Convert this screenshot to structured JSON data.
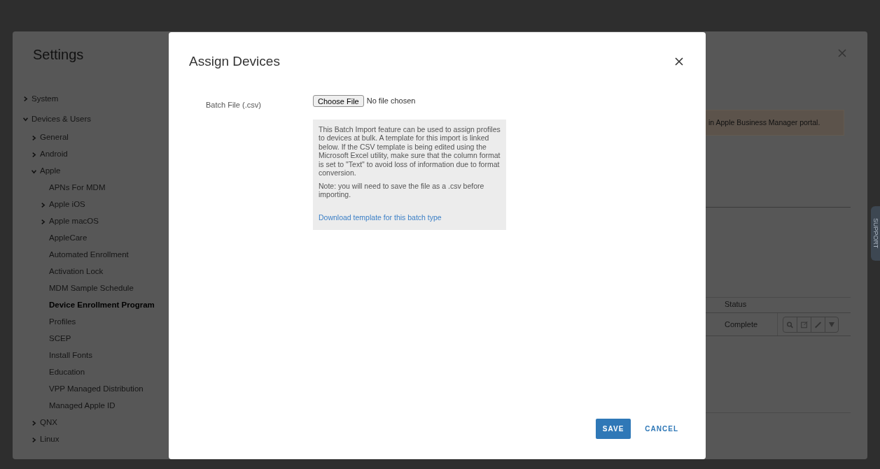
{
  "settings": {
    "title": "Settings",
    "tree": [
      {
        "label": "System",
        "expanded": false,
        "selected": false
      },
      {
        "label": "Devices & Users",
        "expanded": true,
        "selected": false,
        "children": [
          {
            "label": "General",
            "expanded": false,
            "selected": false
          },
          {
            "label": "Android",
            "expanded": false,
            "selected": false
          },
          {
            "label": "Apple",
            "expanded": true,
            "selected": false,
            "children": [
              {
                "label": "APNs For MDM",
                "selected": false
              },
              {
                "label": "Apple iOS",
                "expanded": false,
                "selected": false
              },
              {
                "label": "Apple macOS",
                "expanded": false,
                "selected": false
              },
              {
                "label": "AppleCare",
                "selected": false
              },
              {
                "label": "Automated Enrollment",
                "selected": false
              },
              {
                "label": "Activation Lock",
                "selected": false
              },
              {
                "label": "MDM Sample Schedule",
                "selected": false
              },
              {
                "label": "Device Enrollment Program",
                "selected": true
              },
              {
                "label": "Profiles",
                "selected": false
              },
              {
                "label": "SCEP",
                "selected": false
              },
              {
                "label": "Install Fonts",
                "selected": false
              },
              {
                "label": "Education",
                "selected": false
              },
              {
                "label": "VPP Managed Distribution",
                "selected": false
              },
              {
                "label": "Managed Apple ID",
                "selected": false
              }
            ]
          },
          {
            "label": "QNX",
            "expanded": false,
            "selected": false
          },
          {
            "label": "Linux",
            "expanded": false,
            "selected": false
          }
        ]
      }
    ],
    "banner": "in Apple Business Manager portal.",
    "table": {
      "columns": [
        "Status"
      ],
      "rows": [
        [
          "Complete"
        ]
      ]
    }
  },
  "support_tab": "SUPPORT",
  "dialog": {
    "title": "Assign Devices",
    "field": {
      "label": "Batch File (.csv)",
      "button": "Choose File",
      "value": "No file chosen"
    },
    "help": [
      "This Batch Import feature can be used to assign profiles to devices at bulk. A template for this import is linked below. If the CSV template is being edited using the Microsoft Excel utility, make sure that the column format is set to \"Text\" to avoid loss of information due to format conversion.",
      "Note: you will need to save the file as a .csv before importing."
    ],
    "link": "Download template for this batch type",
    "buttons": [
      {
        "label": "SAVE",
        "kind": "primary"
      },
      {
        "label": "CANCEL",
        "kind": "link"
      }
    ]
  }
}
